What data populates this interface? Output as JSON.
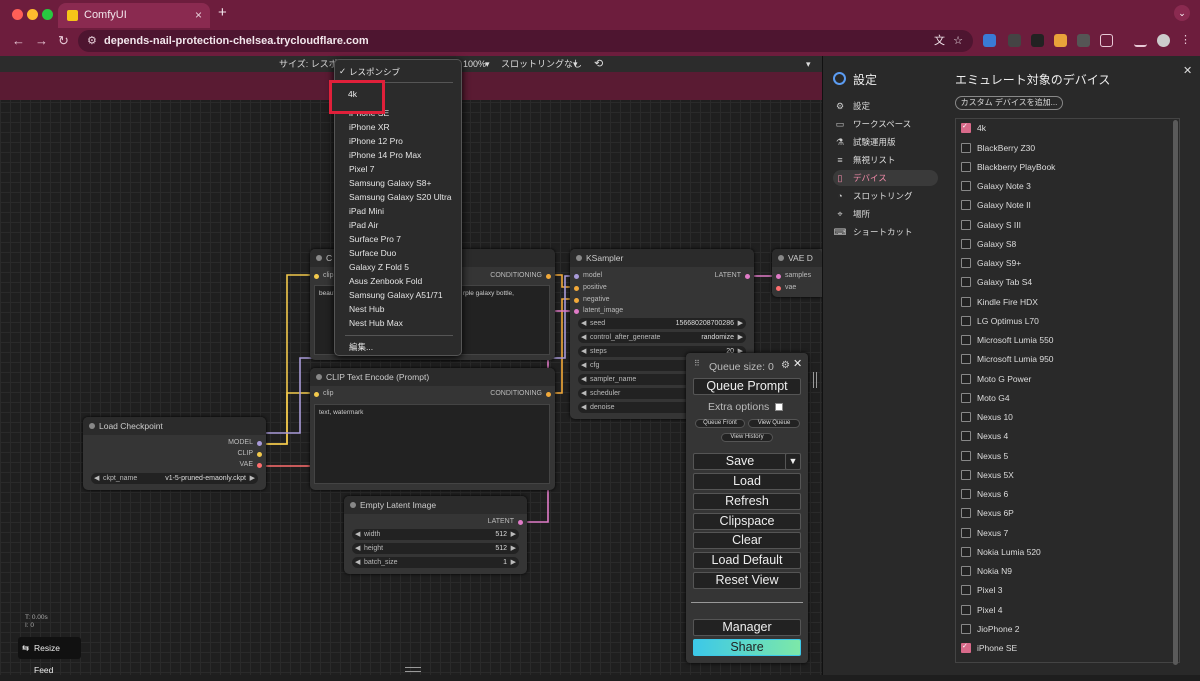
{
  "browser": {
    "tab_title": "ComfyUI",
    "url": "depends-nail-protection-chelsea.trycloudflare.com"
  },
  "toolbar": {
    "size_label": "サイズ: レスポン",
    "zoom": "100%",
    "throttle": "スロットリングなし"
  },
  "dropdown": {
    "items": [
      "レスポンシブ",
      "4k",
      "iPhone SE",
      "iPhone XR",
      "iPhone 12 Pro",
      "iPhone 14 Pro Max",
      "Pixel 7",
      "Samsung Galaxy S8+",
      "Samsung Galaxy S20 Ultra",
      "iPad Mini",
      "iPad Air",
      "Surface Pro 7",
      "Surface Duo",
      "Galaxy Z Fold 5",
      "Asus Zenbook Fold",
      "Samsung Galaxy A51/71",
      "Nest Hub",
      "Nest Hub Max",
      "編集..."
    ]
  },
  "nodes": {
    "clip1": {
      "title": "C",
      "out": "CONDITIONING",
      "in": "clip",
      "text": "beaut",
      "text2": "rple galaxy bottle,"
    },
    "clip2": {
      "title": "CLIP Text Encode (Prompt)",
      "out": "CONDITIONING",
      "in": "clip",
      "text": "text, watermark"
    },
    "ksampler": {
      "title": "KSampler",
      "out": "LATENT",
      "inputs": [
        "model",
        "positive",
        "negative",
        "latent_image"
      ],
      "widgets": [
        {
          "n": "seed",
          "v": "156680208700286"
        },
        {
          "n": "control_after_generate",
          "v": "randomize"
        },
        {
          "n": "steps",
          "v": "20"
        },
        {
          "n": "cfg",
          "v": ""
        },
        {
          "n": "sampler_name",
          "v": ""
        },
        {
          "n": "scheduler",
          "v": ""
        },
        {
          "n": "denoise",
          "v": ""
        }
      ]
    },
    "vae": {
      "title": "VAE D",
      "inputs": [
        "samples",
        "vae"
      ]
    },
    "checkpoint": {
      "title": "Load Checkpoint",
      "outs": [
        "MODEL",
        "CLIP",
        "VAE"
      ],
      "widget_name": "ckpt_name",
      "widget_value": "v1-5-pruned-emaonly.ckpt"
    },
    "latent": {
      "title": "Empty Latent Image",
      "out": "LATENT",
      "widgets": [
        {
          "n": "width",
          "v": "512"
        },
        {
          "n": "height",
          "v": "512"
        },
        {
          "n": "batch_size",
          "v": "1"
        }
      ]
    }
  },
  "queue": {
    "size": "Queue size: 0",
    "queue_prompt": "Queue Prompt",
    "extra": "Extra options",
    "front": "Queue Front",
    "view_queue": "View Queue",
    "history": "View History",
    "save": "Save",
    "load": "Load",
    "refresh": "Refresh",
    "clipspace": "Clipspace",
    "clear": "Clear",
    "load_default": "Load Default",
    "reset_view": "Reset View",
    "manager": "Manager",
    "share": "Share"
  },
  "canvas": {
    "t": "T: 0.00s",
    "i": "I: 0",
    "resize": "Resize Feed"
  },
  "settings": {
    "title": "設定",
    "heading": "エミュレート対象のデバイス",
    "add_btn": "カスタム デバイスを追加...",
    "menu": [
      "設定",
      "ワークスペース",
      "試験運用版",
      "無視リスト",
      "デバイス",
      "スロットリング",
      "場所",
      "ショートカット"
    ],
    "devices": [
      {
        "n": "4k",
        "on": true
      },
      {
        "n": "BlackBerry Z30"
      },
      {
        "n": "Blackberry PlayBook"
      },
      {
        "n": "Galaxy Note 3"
      },
      {
        "n": "Galaxy Note II"
      },
      {
        "n": "Galaxy S III"
      },
      {
        "n": "Galaxy S8"
      },
      {
        "n": "Galaxy S9+"
      },
      {
        "n": "Galaxy Tab S4"
      },
      {
        "n": "Kindle Fire HDX"
      },
      {
        "n": "LG Optimus L70"
      },
      {
        "n": "Microsoft Lumia 550"
      },
      {
        "n": "Microsoft Lumia 950"
      },
      {
        "n": "Moto G Power"
      },
      {
        "n": "Moto G4"
      },
      {
        "n": "Nexus 10"
      },
      {
        "n": "Nexus 4"
      },
      {
        "n": "Nexus 5"
      },
      {
        "n": "Nexus 5X"
      },
      {
        "n": "Nexus 6"
      },
      {
        "n": "Nexus 6P"
      },
      {
        "n": "Nexus 7"
      },
      {
        "n": "Nokia Lumia 520"
      },
      {
        "n": "Nokia N9"
      },
      {
        "n": "Pixel 3"
      },
      {
        "n": "Pixel 4"
      },
      {
        "n": "JioPhone 2"
      },
      {
        "n": "iPhone SE",
        "on": true
      }
    ]
  }
}
